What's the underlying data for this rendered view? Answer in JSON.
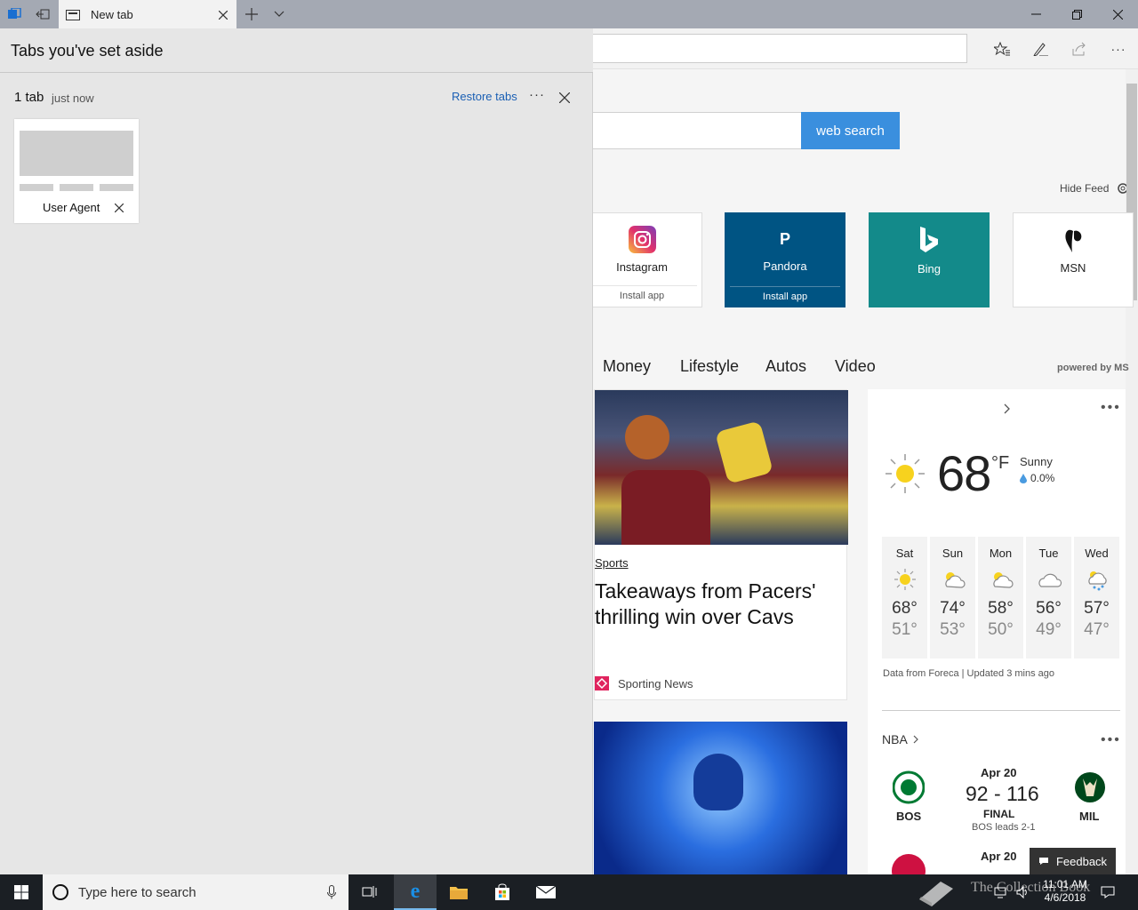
{
  "browser": {
    "tab_title": "New tab",
    "address_value": ""
  },
  "set_aside": {
    "title": "Tabs you've set aside",
    "group_count": "1 tab",
    "group_time": "just now",
    "restore_label": "Restore tabs",
    "tab_label": "User Agent"
  },
  "search": {
    "button_label": "web search"
  },
  "feed": {
    "hide_label": "Hide Feed",
    "tiles": [
      {
        "name": "Instagram",
        "sub": "Install app"
      },
      {
        "name": "Pandora",
        "sub": "Install app",
        "glyph": "P"
      },
      {
        "name": "Bing",
        "sub": ""
      },
      {
        "name": "MSN",
        "sub": ""
      }
    ],
    "nav": [
      "Money",
      "Lifestyle",
      "Autos",
      "Video"
    ],
    "powered_by": "powered by MS",
    "article": {
      "category": "Sports",
      "headline_line1": "Takeaways from Pacers'",
      "headline_line2": "thrilling win over Cavs",
      "source": "Sporting News"
    }
  },
  "weather": {
    "temp": "68",
    "unit": "°F",
    "condition": "Sunny",
    "precip": "0.0%",
    "forecast": [
      {
        "day": "Sat",
        "hi": "68°",
        "lo": "51°",
        "icon": "sun-icon"
      },
      {
        "day": "Sun",
        "hi": "74°",
        "lo": "53°",
        "icon": "partly-cloudy-icon"
      },
      {
        "day": "Mon",
        "hi": "58°",
        "lo": "50°",
        "icon": "partly-cloudy-icon"
      },
      {
        "day": "Tue",
        "hi": "56°",
        "lo": "49°",
        "icon": "cloud-icon"
      },
      {
        "day": "Wed",
        "hi": "57°",
        "lo": "47°",
        "icon": "rain-icon"
      }
    ],
    "source": "Data from Foreca | Updated 3 mins ago"
  },
  "nba": {
    "label": "NBA",
    "game1": {
      "date": "Apr 20",
      "score": "92 - 116",
      "status": "FINAL",
      "series": "BOS leads 2-1",
      "home": "BOS",
      "away": "MIL"
    },
    "game2": {
      "date": "Apr 20"
    }
  },
  "feedback_label": "Feedback",
  "taskbar": {
    "search_placeholder": "Type here to search",
    "time": "11:01 AM",
    "date": "4/6/2018"
  },
  "watermark": "The Collection Book",
  "colors": {
    "accent": "#3a8fde",
    "pandora": "#005483",
    "bing": "#138a8a",
    "link": "#1a5fb4"
  }
}
